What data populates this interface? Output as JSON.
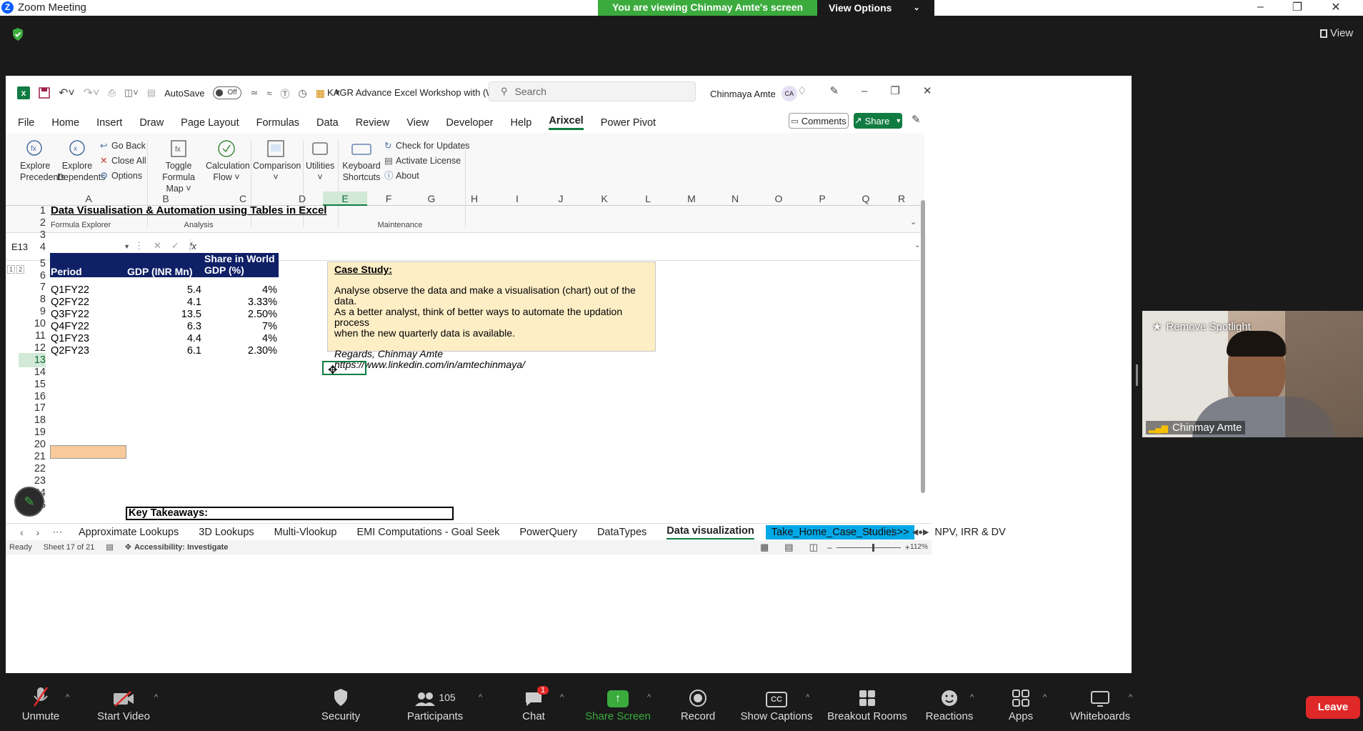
{
  "zoom": {
    "title": "Zoom Meeting",
    "banner": "You are viewing Chinmay Amte's screen",
    "view_options": "View Options",
    "view_label": "View",
    "spotlight": "Remove Spotlight",
    "participant_name": "Chinmay Amte",
    "bottom": {
      "unmute": "Unmute",
      "start_video": "Start Video",
      "security": "Security",
      "participants": "Participants",
      "participants_count": "105",
      "chat": "Chat",
      "chat_badge": "1",
      "share_screen": "Share Screen",
      "record": "Record",
      "captions": "Show Captions",
      "breakout": "Breakout Rooms",
      "reactions": "Reactions",
      "apps": "Apps",
      "whiteboards": "Whiteboards",
      "leave": "Leave"
    }
  },
  "excel": {
    "qat": {
      "autosave": "AutoSave",
      "autosave_state": "Off",
      "doc_title": "KAGR Advance Excel Workshop with (W...",
      "search_placeholder": "Search",
      "user": "Chinmaya Amte",
      "user_initials": "CA"
    },
    "tabs": [
      "File",
      "Home",
      "Insert",
      "Draw",
      "Page Layout",
      "Formulas",
      "Data",
      "Review",
      "View",
      "Developer",
      "Help",
      "Arixcel",
      "Power Pivot"
    ],
    "comments": "Comments",
    "share": "Share",
    "ribbon": {
      "explore_precedents": "Explore Precedents",
      "explore_dependents": "Explore Dependents",
      "go_back": "Go Back",
      "close_all": "Close All",
      "options": "Options",
      "toggle_formula": "Toggle Formula Map",
      "calc_flow": "Calculation Flow",
      "comparison": "Comparison",
      "utilities": "Utilities",
      "keyboard": "Keyboard Shortcuts",
      "check_updates": "Check for Updates",
      "activate": "Activate License",
      "about": "About",
      "grp_formula_explorer": "Formula Explorer",
      "grp_analysis": "Analysis",
      "grp_maintenance": "Maintenance"
    },
    "name_box": "E13",
    "fx": "fx",
    "columns": [
      "A",
      "B",
      "C",
      "D",
      "E",
      "F",
      "G",
      "H",
      "I",
      "J",
      "K",
      "L",
      "M",
      "N",
      "O",
      "P",
      "Q",
      "R"
    ],
    "rows": [
      "1",
      "2",
      "3",
      "4",
      "5",
      "6",
      "7",
      "8",
      "9",
      "10",
      "11",
      "12",
      "13",
      "14",
      "15",
      "16",
      "17",
      "18",
      "19",
      "20",
      "21",
      "22",
      "23",
      "24",
      "25"
    ],
    "sheet_title": "Data Visualisation & Automation using Tables in Excel",
    "table": {
      "headers": [
        "Period",
        "GDP (INR Mn)",
        "Share in World GDP (%)"
      ],
      "rows": [
        [
          "Q1FY22",
          "5.4",
          "4%"
        ],
        [
          "Q2FY22",
          "4.1",
          "3.33%"
        ],
        [
          "Q3FY22",
          "13.5",
          "2.50%"
        ],
        [
          "Q4FY22",
          "6.3",
          "7%"
        ],
        [
          "Q1FY23",
          "4.4",
          "4%"
        ],
        [
          "Q2FY23",
          "6.1",
          "2.30%"
        ]
      ]
    },
    "case_study": {
      "title": "Case Study:",
      "body1": "Analyse observe the data and make a visualisation (chart) out of the data.",
      "body2": "As a better analyst, think of better ways to automate the updation process",
      "body3": "when the new quarterly data is available.",
      "regards": "Regards, Chinmay Amte",
      "link": "https://www.linkedin.com/in/amtechinmaya/"
    },
    "key_takeaways": "Key Takeaways:",
    "sheet_tabs": [
      "Approximate Lookups",
      "3D Lookups",
      "Multi-Vlookup",
      "EMI Computations - Goal Seek",
      "PowerQuery",
      "DataTypes",
      "Data visualization",
      "Take_Home_Case_Studies>>",
      "NPV, IRR & DV"
    ],
    "status": {
      "ready": "Ready",
      "sheet": "Sheet 17 of 21",
      "accessibility": "Accessibility: Investigate",
      "zoom": "112%"
    }
  }
}
